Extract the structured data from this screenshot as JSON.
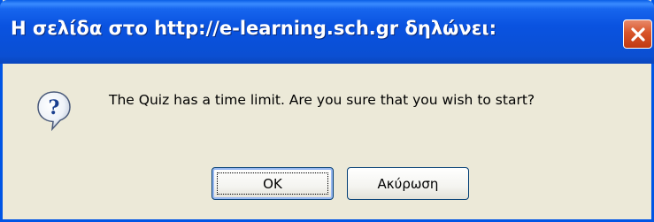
{
  "window": {
    "title": "Η σελίδα στο http://e-learning.sch.gr δηλώνει:",
    "close_icon": "close-icon",
    "accent": "#0055e5",
    "close_color": "#d8542a"
  },
  "dialog": {
    "icon": "question-icon",
    "message": "The Quiz has a time limit. Are you sure that you wish to start?",
    "ok_label": "OK",
    "cancel_label": "Ακύρωση"
  }
}
